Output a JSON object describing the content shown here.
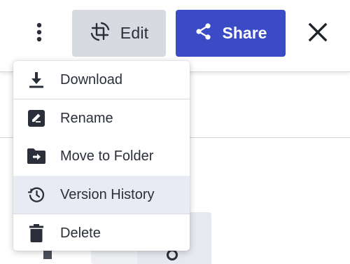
{
  "toolbar": {
    "more_icon": "vertical-ellipsis-icon",
    "edit_label": "Edit",
    "edit_icon": "crop-rotate-icon",
    "share_label": "Share",
    "share_icon": "share-icon",
    "close_icon": "close-icon"
  },
  "menu": {
    "items": [
      {
        "label": "Download",
        "icon": "download-icon"
      },
      {
        "label": "Rename",
        "icon": "rename-icon"
      },
      {
        "label": "Move to Folder",
        "icon": "move-to-folder-icon"
      },
      {
        "label": "Version History",
        "icon": "history-icon",
        "highlighted": true
      },
      {
        "label": "Delete",
        "icon": "trash-icon"
      }
    ]
  },
  "colors": {
    "accent": "#3b4bc6",
    "edit_button_bg": "#d7dae1",
    "highlight_bg": "#e8eaf4",
    "text": "#2a2f3a"
  }
}
